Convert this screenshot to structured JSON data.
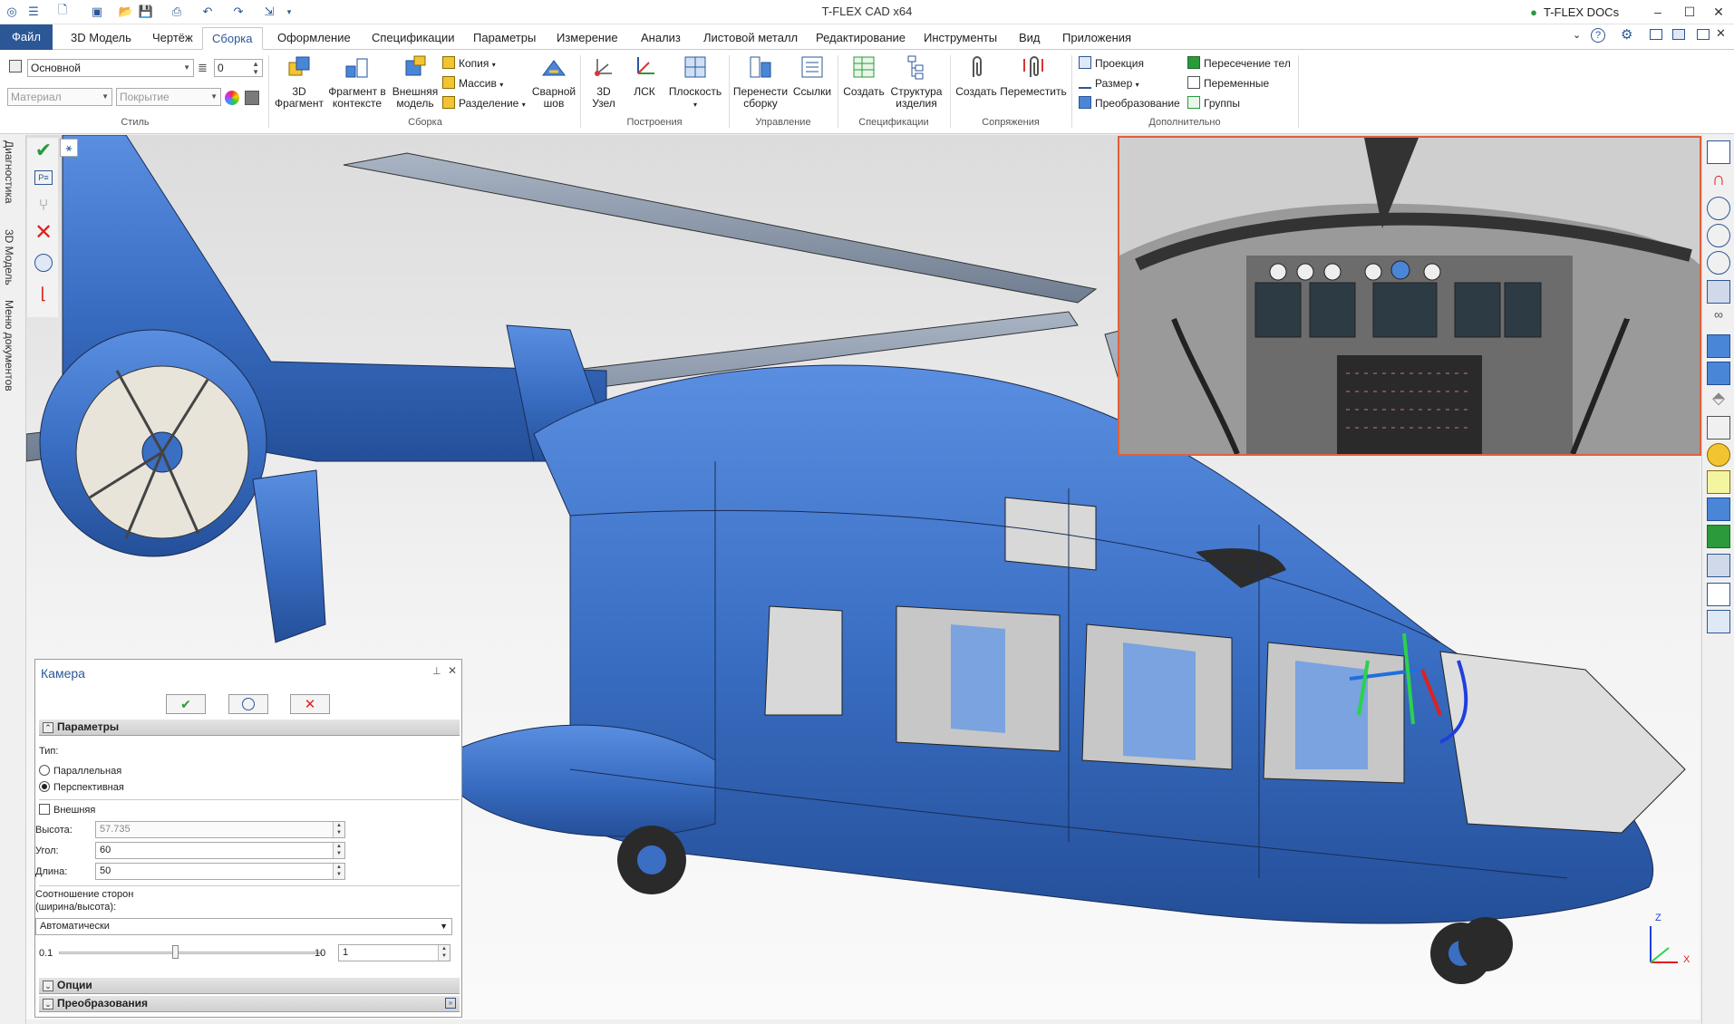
{
  "window": {
    "title": "T-FLEX CAD x64",
    "docs_label": "T-FLEX DOCs"
  },
  "tabs": [
    {
      "label": "Файл"
    },
    {
      "label": "3D Модель"
    },
    {
      "label": "Чертёж"
    },
    {
      "label": "Сборка"
    },
    {
      "label": "Оформление"
    },
    {
      "label": "Спецификации"
    },
    {
      "label": "Параметры"
    },
    {
      "label": "Измерение"
    },
    {
      "label": "Анализ"
    },
    {
      "label": "Листовой металл"
    },
    {
      "label": "Редактирование"
    },
    {
      "label": "Инструменты"
    },
    {
      "label": "Вид"
    },
    {
      "label": "Приложения"
    }
  ],
  "ribbon": {
    "style": {
      "layer": "Основной",
      "level": "0",
      "material_placeholder": "Материал",
      "coating_placeholder": "Покрытие",
      "group_label": "Стиль"
    },
    "assembly": {
      "fragment3d": "3D\nФрагмент",
      "fragment_context": "Фрагмент в\nконтексте",
      "external_model": "Внешняя\nмодель",
      "copy": "Копия",
      "array": "Массив",
      "split": "Разделение",
      "weld": "Сварной\nшов",
      "group_label": "Сборка"
    },
    "construct": {
      "node3d": "3D\nУзел",
      "lsk": "ЛСК",
      "plane": "Плоскость",
      "group_label": "Построения"
    },
    "manage": {
      "move_assembly": "Перенести\nсборку",
      "links": "Ссылки",
      "group_label": "Управление"
    },
    "specs": {
      "create": "Создать",
      "structure": "Структура\nизделия",
      "group_label": "Спецификации"
    },
    "mates": {
      "create": "Создать",
      "move": "Переместить",
      "group_label": "Сопряжения"
    },
    "extra": {
      "projection": "Проекция",
      "dimension": "Размер",
      "transform": "Преобразование",
      "intersection": "Пересечение тел",
      "variables": "Переменные",
      "groups": "Группы",
      "group_label": "Дополнительно"
    }
  },
  "side_tabs": [
    "Диагностика",
    "3D Модель",
    "Меню документов"
  ],
  "camera_panel": {
    "title": "Камера",
    "section_params": "Параметры",
    "type_label": "Тип:",
    "type_options": [
      "Параллельная",
      "Перспективная"
    ],
    "type_selected": "Перспективная",
    "external_label": "Внешняя",
    "external_checked": false,
    "height_label": "Высота:",
    "height_value": "57.735",
    "angle_label": "Угол:",
    "angle_value": "60",
    "length_label": "Длина:",
    "length_value": "50",
    "aspect_label_1": "Соотношение сторон",
    "aspect_label_2": "(ширина/высота):",
    "aspect_mode": "Автоматически",
    "slider_min": "0.1",
    "slider_max": "10",
    "aspect_value": "1",
    "slider_fraction": 0.44,
    "section_options": "Опции",
    "section_transform": "Преобразования"
  },
  "axis_labels": {
    "z": "Z",
    "x": "X"
  },
  "colors": {
    "accent": "#2b5797",
    "fuselage": "#3a6fc4",
    "inset_border": "#e0603a"
  }
}
